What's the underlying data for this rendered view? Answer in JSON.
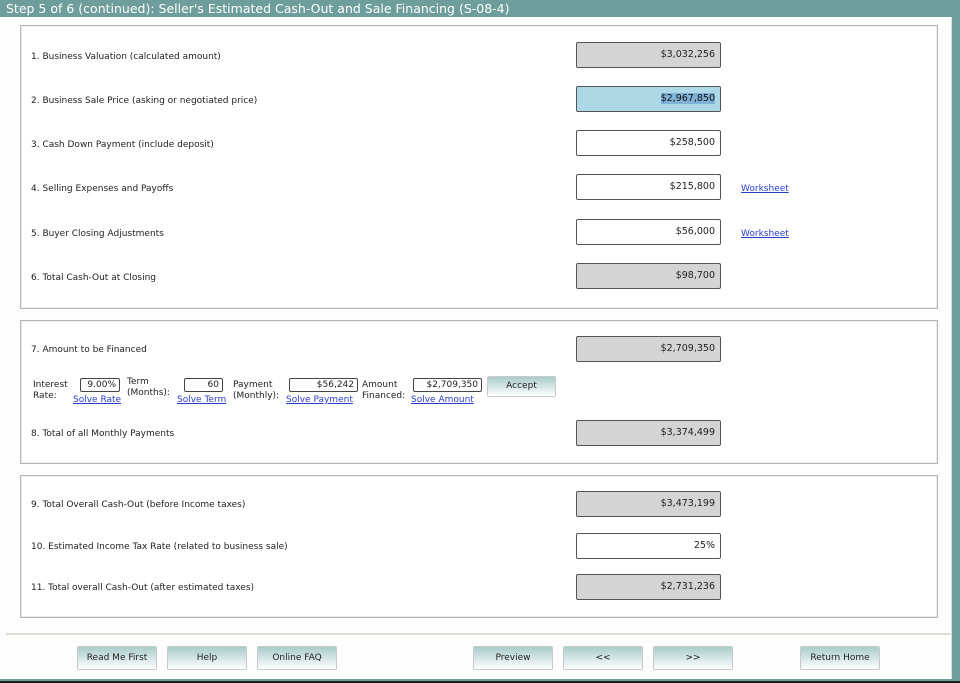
{
  "window": {
    "title": "Step 5 of 6 (continued): Seller's Estimated Cash-Out and Sale Financing (S-08-4)"
  },
  "section1": {
    "rows": [
      {
        "label": "1. Business Valuation (calculated amount)",
        "value": "$3,032,256"
      },
      {
        "label": "2. Business Sale Price (asking or negotiated price)",
        "value": "$2,967,850"
      },
      {
        "label": "3. Cash Down Payment (include deposit)",
        "value": "$258,500"
      },
      {
        "label": "4. Selling Expenses and Payoffs",
        "value": "$215,800",
        "link": "Worksheet"
      },
      {
        "label": "5. Buyer Closing Adjustments",
        "value": "$56,000",
        "link": "Worksheet"
      },
      {
        "label": "6. Total Cash-Out at Closing",
        "value": "$98,700"
      }
    ]
  },
  "section2": {
    "amount_financed": {
      "label": "7. Amount to be Financed",
      "value": "$2,709,350"
    },
    "calculator": {
      "interest_rate": {
        "label1": "Interest",
        "label2": "Rate:",
        "value": "9.00%",
        "solve": "Solve Rate"
      },
      "term": {
        "label1": "Term",
        "label2": "(Months):",
        "value": "60",
        "solve": "Solve Term"
      },
      "payment": {
        "label1": "Payment",
        "label2": "(Monthly):",
        "value": "$56,242",
        "solve": "Solve Payment"
      },
      "amount": {
        "label1": "Amount",
        "label2": "Financed:",
        "value": "$2,709,350",
        "solve": "Solve Amount"
      },
      "accept_label": "Accept"
    },
    "total_payments": {
      "label": "8. Total of all Monthly Payments",
      "value": "$3,374,499"
    }
  },
  "section3": {
    "rows": [
      {
        "label": "9. Total Overall Cash-Out (before Income taxes)",
        "value": "$3,473,199"
      },
      {
        "label": "10. Estimated Income Tax Rate (related to business sale)",
        "value": "25%"
      },
      {
        "label": "11. Total overall Cash-Out (after estimated taxes)",
        "value": "$2,731,236"
      }
    ]
  },
  "footer": {
    "read_me_first": "Read Me First",
    "help": "Help",
    "online_faq": "Online FAQ",
    "preview": "Preview",
    "back": "<<",
    "next": ">>",
    "return_home": "Return Home"
  }
}
